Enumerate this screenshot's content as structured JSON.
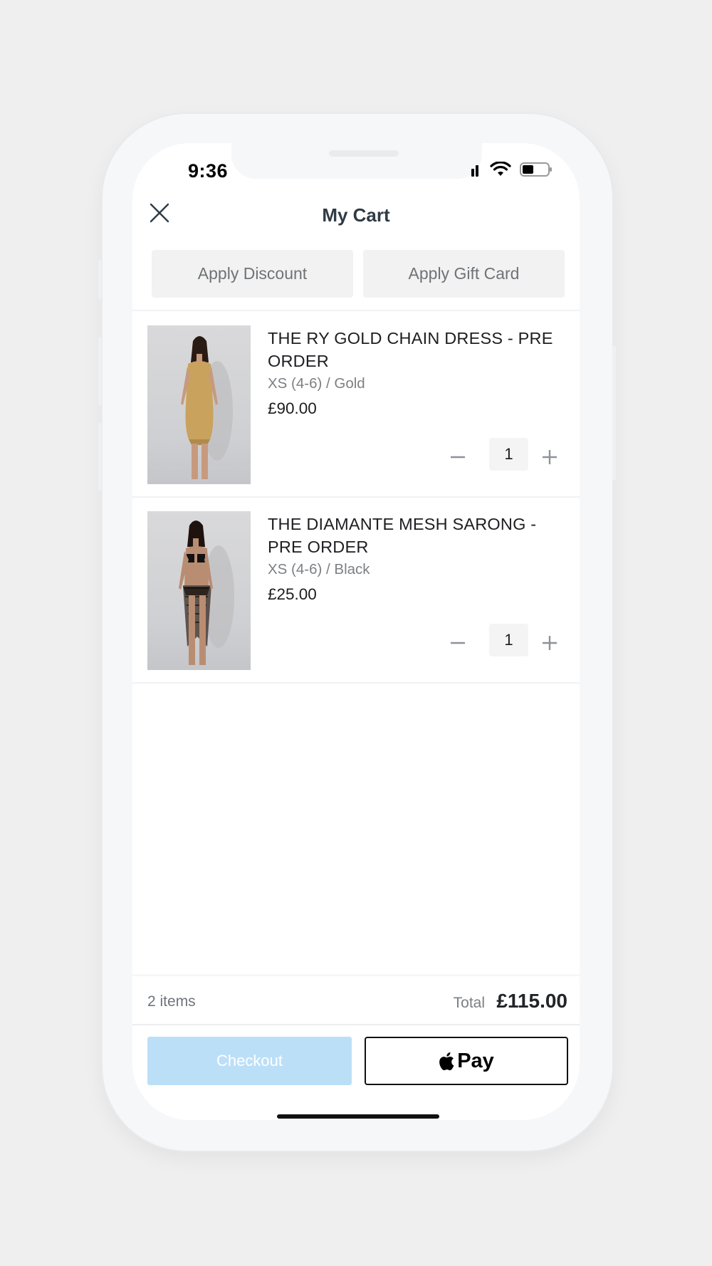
{
  "status_bar": {
    "time": "9:36"
  },
  "header": {
    "title": "My Cart"
  },
  "actions": {
    "discount_label": "Apply Discount",
    "gift_card_label": "Apply Gift Card"
  },
  "items": [
    {
      "name": "THE RY GOLD CHAIN DRESS - PRE ORDER",
      "variant": "XS (4-6) / Gold",
      "price": "£90.00",
      "quantity": "1"
    },
    {
      "name": "THE DIAMANTE MESH SARONG - PRE ORDER",
      "variant": "XS (4-6) / Black",
      "price": "£25.00",
      "quantity": "1"
    }
  ],
  "summary": {
    "items_count": "2 items",
    "total_label": "Total",
    "total_value": "£115.00"
  },
  "buttons": {
    "checkout_label": "Checkout",
    "apple_pay_label": "Pay"
  },
  "colors": {
    "checkout_disabled": "#bcdff8",
    "title_text": "#2f3b45",
    "background": "#efefef"
  },
  "icons": [
    "close-icon",
    "minus-icon",
    "plus-icon",
    "apple-logo-icon",
    "signal-icon",
    "wifi-icon",
    "battery-icon"
  ]
}
